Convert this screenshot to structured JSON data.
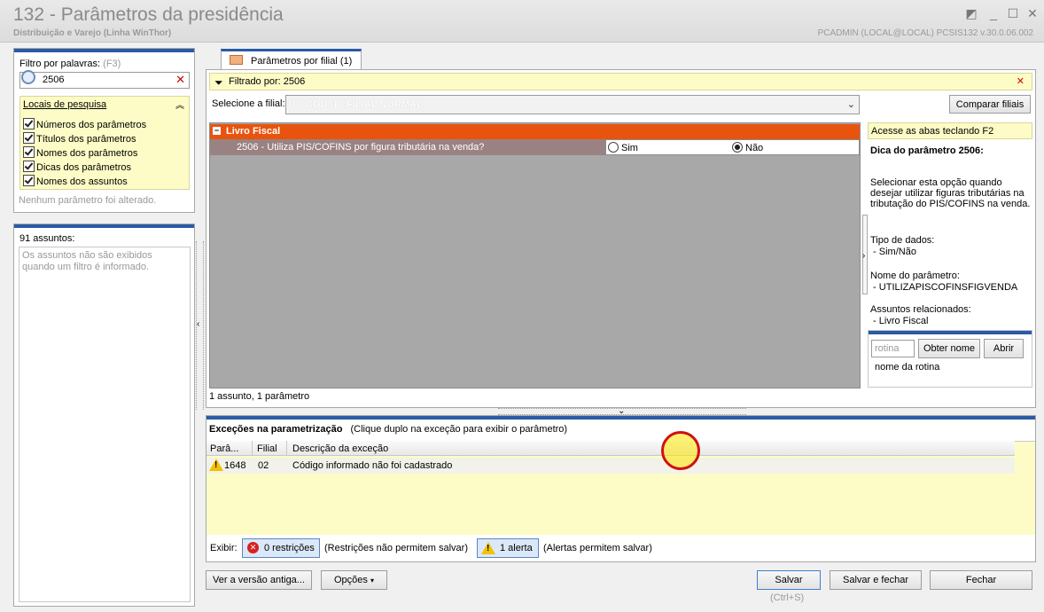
{
  "window": {
    "title": "132 - Parâmetros da presidência",
    "subtitle": "Distribuição e Varejo (Linha WinThor)",
    "user_info": "PCADMIN (LOCAL@LOCAL)   PCSIS132  v.30.0.06.002"
  },
  "filter": {
    "label": "Filtro por palavras:",
    "shortcut": "(F3)",
    "value": "2506",
    "search_places_title": "Locais de pesquisa",
    "options": [
      "Números dos parâmetros",
      "Títulos dos parâmetros",
      "Nomes dos parâmetros",
      "Dicas dos parâmetros",
      "Nomes dos assuntos"
    ],
    "status": "Nenhum parâmetro foi alterado."
  },
  "subjects": {
    "title": "91 assuntos:",
    "message": "Os assuntos não são exibidos quando um filtro é informado."
  },
  "tab": {
    "label": "Parâmetros por filial",
    "count": "(1)"
  },
  "filtered_by": "Filtrado por: 2506",
  "branch": {
    "label": "Selecione a filial:",
    "value": "1 - COD. 1 - FILIAL NORMAL",
    "compare_button": "Comparar filiais"
  },
  "group": {
    "name": "Livro Fiscal",
    "param": "2506 - Utiliza PIS/COFINS por figura tributária na venda?",
    "yes": "Sim",
    "no": "Não"
  },
  "summary": "1 assunto, 1 parâmetro",
  "hint": {
    "shortcut_note": "Acesse as abas teclando F2",
    "title": "Dica do parâmetro 2506:",
    "description": "Selecionar esta opção quando desejar utilizar figuras tributárias na tributação do PIS/COFINS na venda.",
    "data_type_label": "Tipo de dados:",
    "data_type": " - Sim/Não",
    "param_name_label": "Nome do parâmetro:",
    "param_name": " - UTILIZAPISCOFINSFIGVENDA",
    "subjects_label": "Assuntos relacionados:",
    "subject": " - Livro Fiscal"
  },
  "routine": {
    "placeholder": "rotina",
    "get_name": "Obter nome",
    "open": "Abrir",
    "name_label": "nome da rotina"
  },
  "exceptions": {
    "title": "Exceções na parametrização",
    "subtitle": "(Clique duplo na exceção para exibir o parâmetro)",
    "columns": [
      "Parâ...",
      "Filial",
      "Descrição da exceção"
    ],
    "rows": [
      {
        "param": "1648",
        "branch": "02",
        "description": "Código informado não foi cadastrado"
      }
    ]
  },
  "display": {
    "label": "Exibir:",
    "restrictions": "0 restrições",
    "restrictions_note": "(Restrições não permitem salvar)",
    "alerts": "1 alerta",
    "alerts_note": "(Alertas permitem salvar)"
  },
  "footer": {
    "old_version": "Ver a versão antiga...",
    "options": "Opções",
    "save": "Salvar",
    "save_shortcut": "(Ctrl+S)",
    "save_close": "Salvar e fechar",
    "close": "Fechar"
  }
}
